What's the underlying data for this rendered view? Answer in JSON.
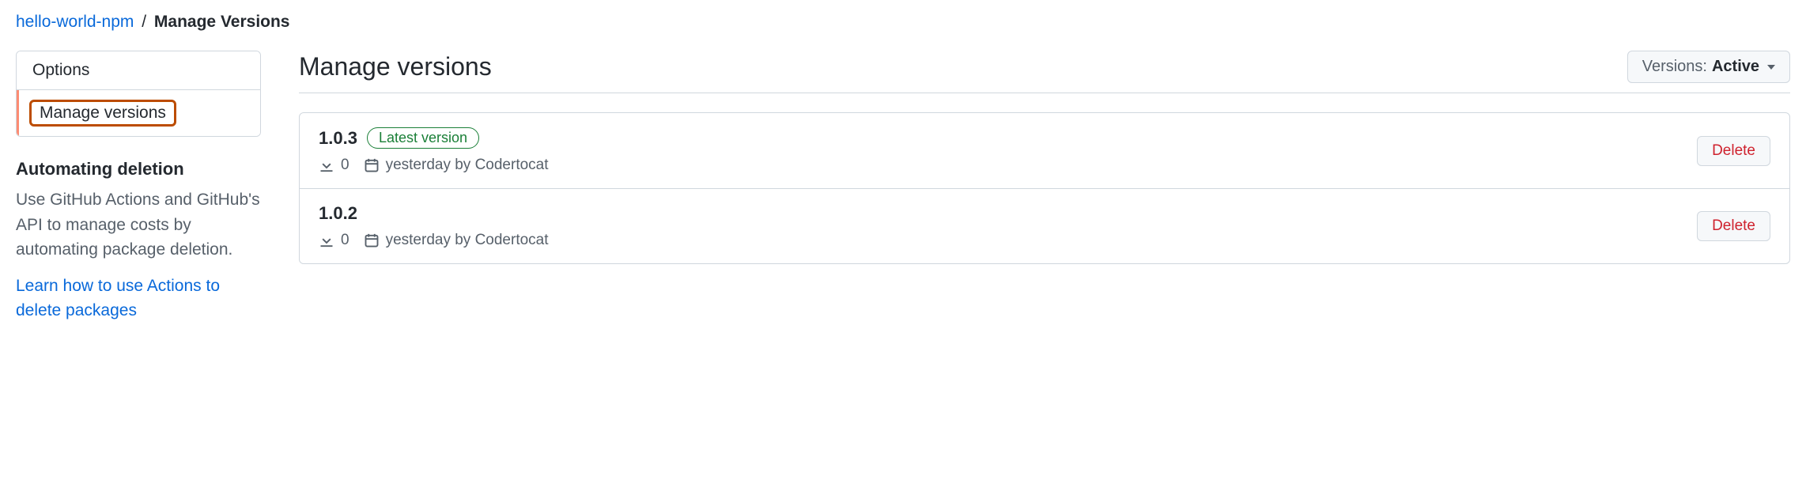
{
  "breadcrumb": {
    "package_link": "hello-world-npm",
    "separator": "/",
    "current": "Manage Versions"
  },
  "sidebar": {
    "items": [
      {
        "label": "Options",
        "active": false
      },
      {
        "label": "Manage versions",
        "active": true
      }
    ],
    "automation": {
      "heading": "Automating deletion",
      "description": "Use GitHub Actions and GitHub's API to manage costs by automating package deletion.",
      "link_text": "Learn how to use Actions to delete packages"
    }
  },
  "main": {
    "title": "Manage versions",
    "filter": {
      "label": "Versions:",
      "value": "Active"
    },
    "latest_badge": "Latest version",
    "delete_label": "Delete",
    "versions": [
      {
        "number": "1.0.3",
        "latest": true,
        "downloads": "0",
        "published": "yesterday by Codertocat"
      },
      {
        "number": "1.0.2",
        "latest": false,
        "downloads": "0",
        "published": "yesterday by Codertocat"
      }
    ]
  }
}
